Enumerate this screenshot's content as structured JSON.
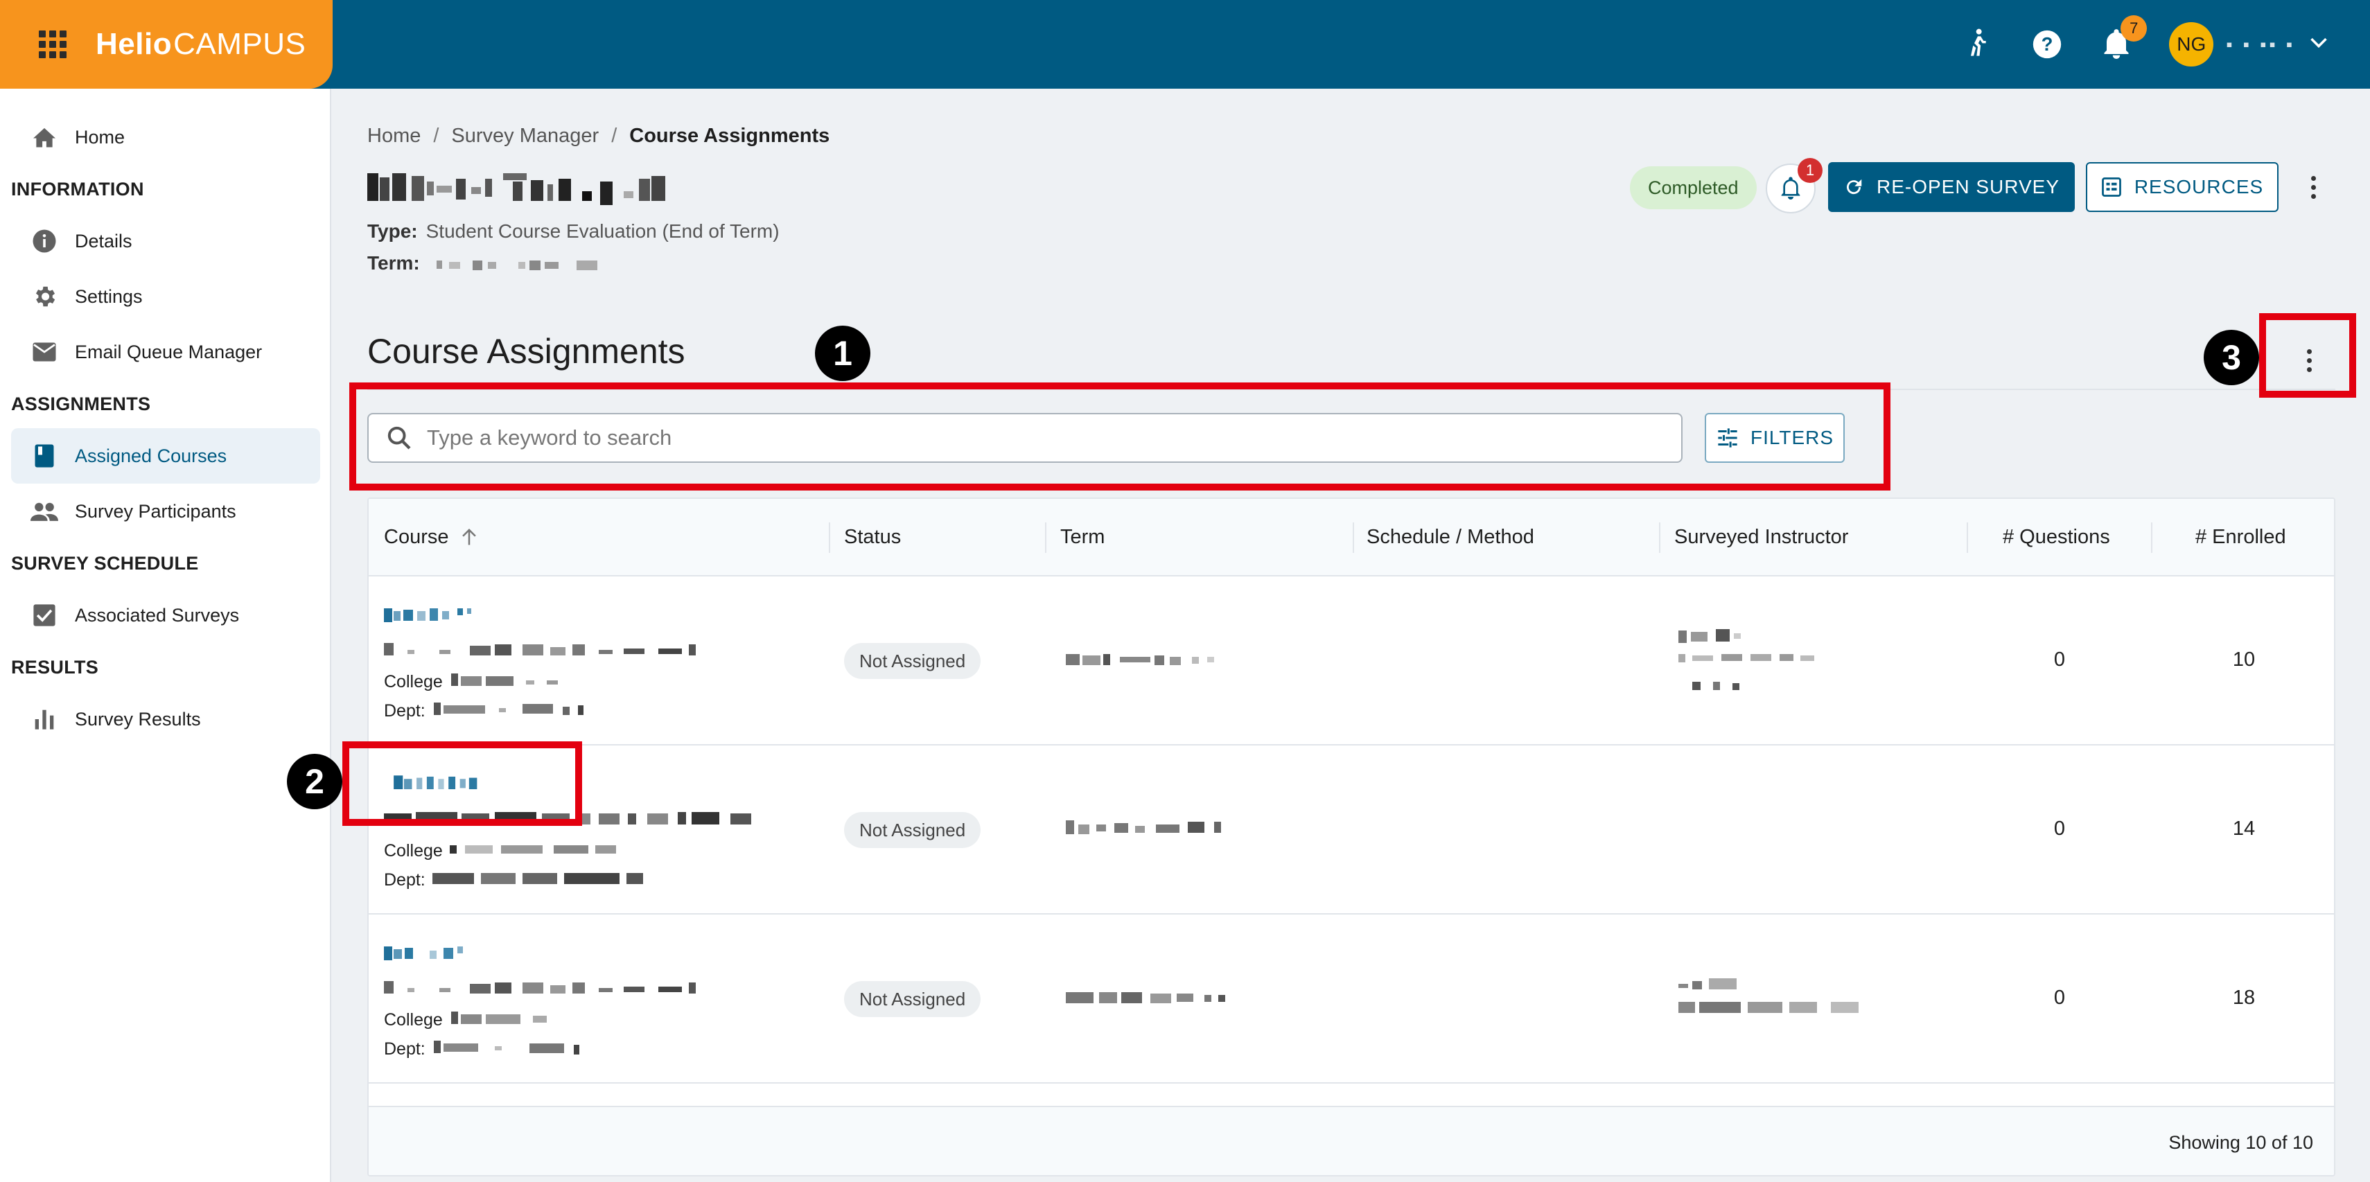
{
  "topbar": {
    "brand_part1": "Helio",
    "brand_part2": "CAMPUS",
    "alerts_count": "7",
    "user_initials": "NG",
    "user_name": "▪ ▪ ▪▪ ▪"
  },
  "sidebar": {
    "home": "Home",
    "section_information": "INFORMATION",
    "details": "Details",
    "settings": "Settings",
    "email_queue": "Email Queue Manager",
    "section_assignments": "ASSIGNMENTS",
    "assigned_courses": "Assigned Courses",
    "survey_participants": "Survey Participants",
    "section_schedule": "SURVEY SCHEDULE",
    "associated_surveys": "Associated Surveys",
    "section_results": "RESULTS",
    "survey_results": "Survey Results"
  },
  "breadcrumb": {
    "home": "Home",
    "survey_manager": "Survey Manager",
    "current": "Course Assignments"
  },
  "survey": {
    "type_label": "Type:",
    "type_value": "Student Course Evaluation (End of Term)",
    "term_label": "Term:",
    "status": "Completed",
    "notifications_count": "1",
    "reopen_label": "RE-OPEN SURVEY",
    "resources_label": "RESOURCES"
  },
  "assignments": {
    "title": "Course Assignments",
    "search_placeholder": "Type a keyword to search",
    "filters_label": "FILTERS",
    "columns": {
      "course": "Course",
      "status": "Status",
      "term": "Term",
      "schedule": "Schedule / Method",
      "instructor": "Surveyed Instructor",
      "questions": "# Questions",
      "enrolled": "# Enrolled"
    },
    "rows": [
      {
        "college_label": "College",
        "dept_label": "Dept:",
        "status": "Not Assigned",
        "questions": "0",
        "enrolled": "10"
      },
      {
        "college_label": "College",
        "dept_label": "Dept:",
        "status": "Not Assigned",
        "questions": "0",
        "enrolled": "14"
      },
      {
        "college_label": "College",
        "dept_label": "Dept:",
        "status": "Not Assigned",
        "questions": "0",
        "enrolled": "18"
      }
    ],
    "footer_text": "Showing 10 of 10"
  },
  "annotations": {
    "one": "1",
    "two": "2",
    "three": "3"
  },
  "colors": {
    "primary": "#005a82",
    "brand": "#f7941d",
    "annotation": "#e3000f"
  }
}
